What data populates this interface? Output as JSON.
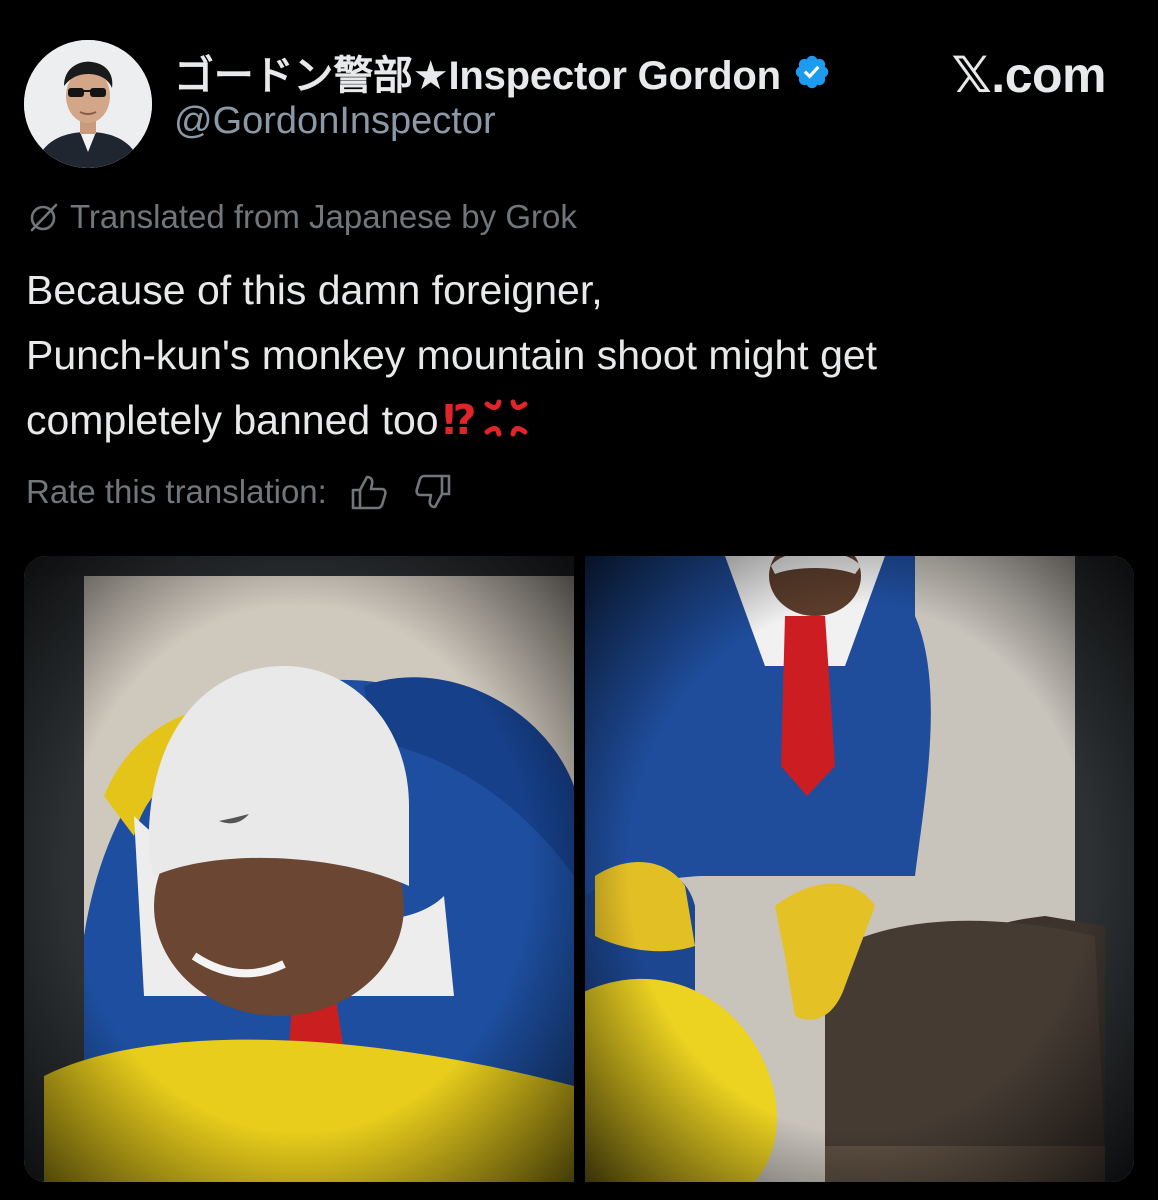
{
  "post": {
    "author": {
      "display_name": "ゴードン警部★Inspector Gordon",
      "handle": "@GordonInspector",
      "verified": true,
      "verified_color": "#1d9bf0"
    },
    "site_brand": "𝕏.com",
    "translation": {
      "notice": "Translated from Japanese by Grok",
      "rate_label": "Rate this translation:",
      "icons": [
        "thumbs-up-icon",
        "thumbs-down-icon"
      ]
    },
    "text_lines": [
      "Because of this damn foreigner,",
      "Punch-kun's monkey mountain shoot might get",
      "completely banned too"
    ],
    "text_emoji": {
      "exclamation_question": "⁉",
      "anger_symbol": "💢"
    },
    "media": {
      "photos": [
        "photo-1",
        "photo-2"
      ]
    }
  },
  "colors": {
    "background": "#000000",
    "primary_text": "#e7e9ea",
    "secondary_text": "#71767b",
    "handle_text": "#8b98a5",
    "emoji_red": "#e0242a"
  }
}
